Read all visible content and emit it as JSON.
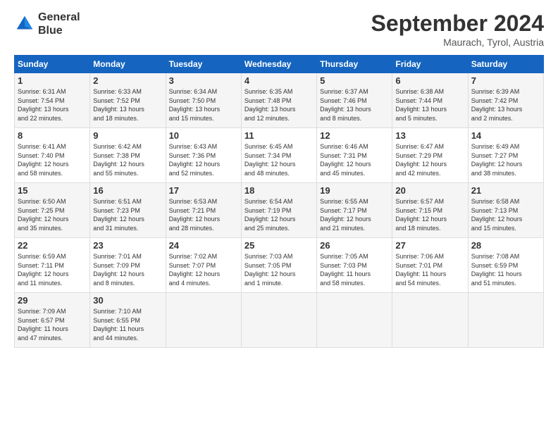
{
  "header": {
    "logo_line1": "General",
    "logo_line2": "Blue",
    "month": "September 2024",
    "location": "Maurach, Tyrol, Austria"
  },
  "weekdays": [
    "Sunday",
    "Monday",
    "Tuesday",
    "Wednesday",
    "Thursday",
    "Friday",
    "Saturday"
  ],
  "weeks": [
    [
      {
        "day": "1",
        "info": "Sunrise: 6:31 AM\nSunset: 7:54 PM\nDaylight: 13 hours\nand 22 minutes."
      },
      {
        "day": "2",
        "info": "Sunrise: 6:33 AM\nSunset: 7:52 PM\nDaylight: 13 hours\nand 18 minutes."
      },
      {
        "day": "3",
        "info": "Sunrise: 6:34 AM\nSunset: 7:50 PM\nDaylight: 13 hours\nand 15 minutes."
      },
      {
        "day": "4",
        "info": "Sunrise: 6:35 AM\nSunset: 7:48 PM\nDaylight: 13 hours\nand 12 minutes."
      },
      {
        "day": "5",
        "info": "Sunrise: 6:37 AM\nSunset: 7:46 PM\nDaylight: 13 hours\nand 8 minutes."
      },
      {
        "day": "6",
        "info": "Sunrise: 6:38 AM\nSunset: 7:44 PM\nDaylight: 13 hours\nand 5 minutes."
      },
      {
        "day": "7",
        "info": "Sunrise: 6:39 AM\nSunset: 7:42 PM\nDaylight: 13 hours\nand 2 minutes."
      }
    ],
    [
      {
        "day": "8",
        "info": "Sunrise: 6:41 AM\nSunset: 7:40 PM\nDaylight: 12 hours\nand 58 minutes."
      },
      {
        "day": "9",
        "info": "Sunrise: 6:42 AM\nSunset: 7:38 PM\nDaylight: 12 hours\nand 55 minutes."
      },
      {
        "day": "10",
        "info": "Sunrise: 6:43 AM\nSunset: 7:36 PM\nDaylight: 12 hours\nand 52 minutes."
      },
      {
        "day": "11",
        "info": "Sunrise: 6:45 AM\nSunset: 7:34 PM\nDaylight: 12 hours\nand 48 minutes."
      },
      {
        "day": "12",
        "info": "Sunrise: 6:46 AM\nSunset: 7:31 PM\nDaylight: 12 hours\nand 45 minutes."
      },
      {
        "day": "13",
        "info": "Sunrise: 6:47 AM\nSunset: 7:29 PM\nDaylight: 12 hours\nand 42 minutes."
      },
      {
        "day": "14",
        "info": "Sunrise: 6:49 AM\nSunset: 7:27 PM\nDaylight: 12 hours\nand 38 minutes."
      }
    ],
    [
      {
        "day": "15",
        "info": "Sunrise: 6:50 AM\nSunset: 7:25 PM\nDaylight: 12 hours\nand 35 minutes."
      },
      {
        "day": "16",
        "info": "Sunrise: 6:51 AM\nSunset: 7:23 PM\nDaylight: 12 hours\nand 31 minutes."
      },
      {
        "day": "17",
        "info": "Sunrise: 6:53 AM\nSunset: 7:21 PM\nDaylight: 12 hours\nand 28 minutes."
      },
      {
        "day": "18",
        "info": "Sunrise: 6:54 AM\nSunset: 7:19 PM\nDaylight: 12 hours\nand 25 minutes."
      },
      {
        "day": "19",
        "info": "Sunrise: 6:55 AM\nSunset: 7:17 PM\nDaylight: 12 hours\nand 21 minutes."
      },
      {
        "day": "20",
        "info": "Sunrise: 6:57 AM\nSunset: 7:15 PM\nDaylight: 12 hours\nand 18 minutes."
      },
      {
        "day": "21",
        "info": "Sunrise: 6:58 AM\nSunset: 7:13 PM\nDaylight: 12 hours\nand 15 minutes."
      }
    ],
    [
      {
        "day": "22",
        "info": "Sunrise: 6:59 AM\nSunset: 7:11 PM\nDaylight: 12 hours\nand 11 minutes."
      },
      {
        "day": "23",
        "info": "Sunrise: 7:01 AM\nSunset: 7:09 PM\nDaylight: 12 hours\nand 8 minutes."
      },
      {
        "day": "24",
        "info": "Sunrise: 7:02 AM\nSunset: 7:07 PM\nDaylight: 12 hours\nand 4 minutes."
      },
      {
        "day": "25",
        "info": "Sunrise: 7:03 AM\nSunset: 7:05 PM\nDaylight: 12 hours\nand 1 minute."
      },
      {
        "day": "26",
        "info": "Sunrise: 7:05 AM\nSunset: 7:03 PM\nDaylight: 11 hours\nand 58 minutes."
      },
      {
        "day": "27",
        "info": "Sunrise: 7:06 AM\nSunset: 7:01 PM\nDaylight: 11 hours\nand 54 minutes."
      },
      {
        "day": "28",
        "info": "Sunrise: 7:08 AM\nSunset: 6:59 PM\nDaylight: 11 hours\nand 51 minutes."
      }
    ],
    [
      {
        "day": "29",
        "info": "Sunrise: 7:09 AM\nSunset: 6:57 PM\nDaylight: 11 hours\nand 47 minutes."
      },
      {
        "day": "30",
        "info": "Sunrise: 7:10 AM\nSunset: 6:55 PM\nDaylight: 11 hours\nand 44 minutes."
      },
      {
        "day": "",
        "info": ""
      },
      {
        "day": "",
        "info": ""
      },
      {
        "day": "",
        "info": ""
      },
      {
        "day": "",
        "info": ""
      },
      {
        "day": "",
        "info": ""
      }
    ]
  ]
}
